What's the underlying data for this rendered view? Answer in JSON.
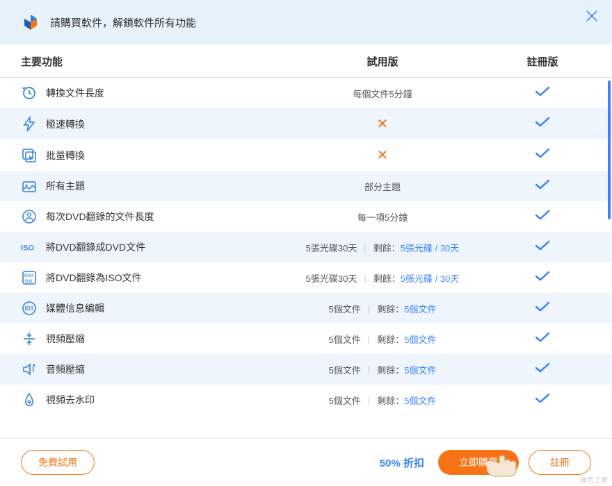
{
  "header": {
    "title": "請購買軟件，解鎖軟件所有功能"
  },
  "columns": {
    "feature": "主要功能",
    "trial": "試用版",
    "registered": "註冊版"
  },
  "rows": [
    {
      "icon": "clock-cycle",
      "label": "轉換文件長度",
      "trial": {
        "type": "text",
        "value": "每個文件5分鐘"
      }
    },
    {
      "icon": "lightning",
      "label": "極速轉換",
      "trial": {
        "type": "cross"
      }
    },
    {
      "icon": "batch",
      "label": "批量轉換",
      "trial": {
        "type": "cross"
      }
    },
    {
      "icon": "themes",
      "label": "所有主題",
      "trial": {
        "type": "text",
        "value": "部分主題"
      }
    },
    {
      "icon": "dvd-person",
      "label": "每次DVD翻錄的文件長度",
      "trial": {
        "type": "text",
        "value": "每一項5分鐘"
      }
    },
    {
      "icon": "iso",
      "label": "將DVD翻錄成DVD文件",
      "trial": {
        "type": "remain",
        "main": "5張光碟30天",
        "remain_label": "剩餘：",
        "remain_value": "5張光碟 / 30天"
      }
    },
    {
      "icon": "dvd-iso",
      "label": "將DVD翻錄為ISO文件",
      "trial": {
        "type": "remain",
        "main": "5張光碟30天",
        "remain_label": "剩餘：",
        "remain_value": "5張光碟 / 30天"
      }
    },
    {
      "icon": "id3",
      "label": "媒體信息編輯",
      "trial": {
        "type": "remain",
        "main": "5個文件",
        "remain_label": "剩餘：",
        "remain_value": "5個文件"
      }
    },
    {
      "icon": "video-compress",
      "label": "視頻壓縮",
      "trial": {
        "type": "remain",
        "main": "5個文件",
        "remain_label": "剩餘：",
        "remain_value": "5個文件"
      }
    },
    {
      "icon": "audio-compress",
      "label": "音頻壓縮",
      "trial": {
        "type": "remain",
        "main": "5個文件",
        "remain_label": "剩餘：",
        "remain_value": "5個文件"
      }
    },
    {
      "icon": "watermark",
      "label": "視頻去水印",
      "trial": {
        "type": "remain",
        "main": "5個文件",
        "remain_label": "剩餘：",
        "remain_value": "5個文件"
      }
    }
  ],
  "footer": {
    "trial_button": "免費試用",
    "discount": "50% 折扣",
    "buy_button": "立即購買",
    "register_button": "註冊"
  },
  "watermark": "綠色工廠"
}
